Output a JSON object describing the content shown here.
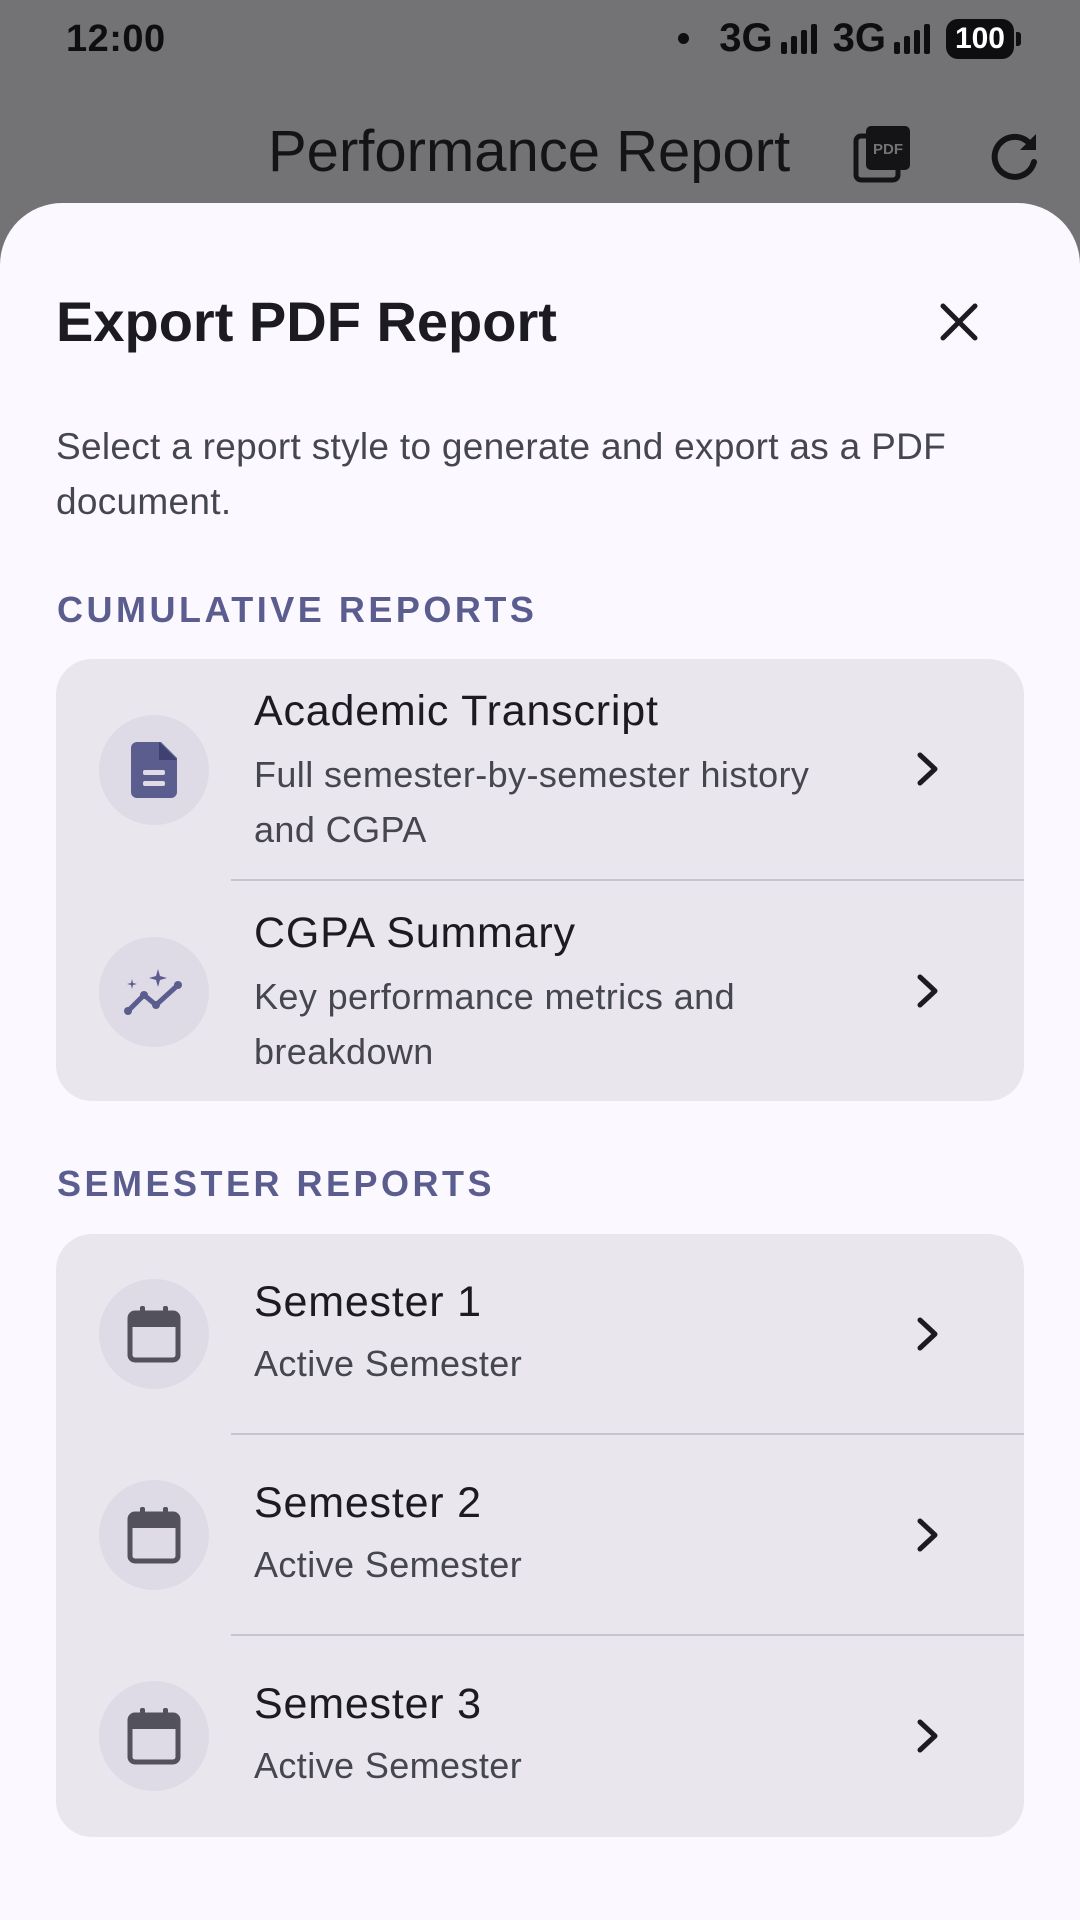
{
  "status_bar": {
    "time": "12:00",
    "network1": "3G",
    "network2": "3G",
    "battery": "100"
  },
  "app_bar": {
    "title": "Performance Report",
    "pdf_icon_text": "PDF"
  },
  "sheet": {
    "title": "Export PDF Report",
    "description": "Select a report style to generate and export as a PDF document.",
    "sections": [
      {
        "label": "CUMULATIVE REPORTS",
        "items": [
          {
            "title": "Academic Transcript",
            "subtitle": "Full semester-by-semester history and CGPA",
            "icon": "document-icon"
          },
          {
            "title": "CGPA Summary",
            "subtitle": "Key performance metrics and breakdown",
            "icon": "sparkle-chart-icon"
          }
        ]
      },
      {
        "label": "SEMESTER REPORTS",
        "items": [
          {
            "title": "Semester 1",
            "subtitle": "Active Semester",
            "icon": "calendar-icon"
          },
          {
            "title": "Semester 2",
            "subtitle": "Active Semester",
            "icon": "calendar-icon"
          },
          {
            "title": "Semester 3",
            "subtitle": "Active Semester",
            "icon": "calendar-icon"
          }
        ]
      }
    ]
  },
  "colors": {
    "accent": "#5b5d8f",
    "sheet_bg": "#fbf8ff",
    "card_bg": "#e9e6ed",
    "scrim": "#737274"
  }
}
